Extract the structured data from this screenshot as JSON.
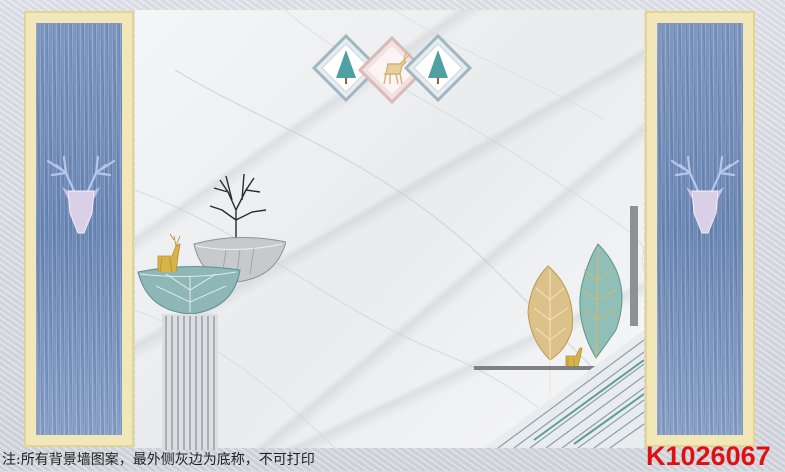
{
  "caption": "注:所有背景墙图案，最外侧灰边为底称，不可打印",
  "product_code": "K1026067",
  "colors": {
    "code_red": "#e01010",
    "panel_blue": "#7390bb",
    "panel_gold": "#f2e7b8",
    "leaf_teal": "#7ab0ad",
    "leaf_gold": "#d8bb7a"
  },
  "icons": [
    "deer-head-icon",
    "tree-icon",
    "deer-icon",
    "leaf-icon",
    "bare-tree-icon"
  ]
}
